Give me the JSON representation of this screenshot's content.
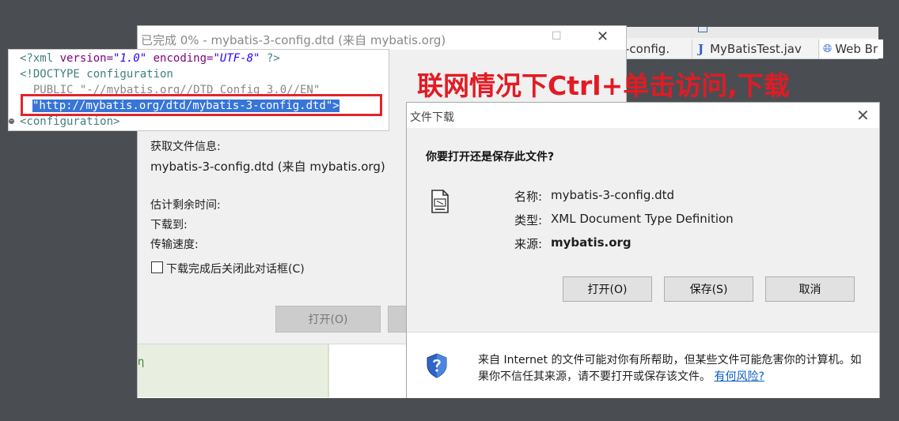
{
  "ide": {
    "tabs": [
      {
        "label": "-config."
      },
      {
        "label": "MyBatisTest.jav"
      },
      {
        "label": "Web Br"
      }
    ]
  },
  "progress_window": {
    "title": "已完成 0% - mybatis-3-config.dtd (来自 mybatis.org)",
    "getting_info_label": "获取文件信息:",
    "file_source": "mybatis-3-config.dtd (来自 mybatis.org)",
    "time_left_label": "估计剩余时间:",
    "download_to_label": "下载到:",
    "transfer_rate_label": "传输速度:",
    "close_on_complete_label": "下载完成后关闭此对话框(C)",
    "open_button": "打开(O)",
    "green_glyph": "η"
  },
  "code": {
    "line1": [
      "<?xml ",
      "version=",
      "\"1.0\"",
      " encoding=",
      "\"UTF-8\"",
      " ?>"
    ],
    "line2": "<!DOCTYPE configuration",
    "line3": "  PUBLIC \"-//mybatis.org//DTD Config 3.0//EN\"",
    "line4": "\"http://mybatis.org/dtd/mybatis-3-config.dtd\">",
    "line5": "<configuration>"
  },
  "annotation": "联网情况下Ctrl+单击访问,下载",
  "dialog": {
    "title": "文件下载",
    "question": "你要打开还是保存此文件?",
    "name_label": "名称:",
    "name_value": "mybatis-3-config.dtd",
    "type_label": "类型:",
    "type_value": "XML Document Type Definition",
    "from_label": "来源:",
    "from_value": "mybatis.org",
    "open_button": "打开(O)",
    "save_button": "保存(S)",
    "cancel_button": "取消",
    "warning_text": "来自 Internet 的文件可能对你有所帮助，但某些文件可能危害你的计算机。如果你不信任其来源，请不要打开或保存该文件。",
    "risk_link": "有何风险?"
  },
  "colors": {
    "annotation": "#e21b24",
    "highlight": "#3875d7",
    "link": "#0a5bc4"
  }
}
